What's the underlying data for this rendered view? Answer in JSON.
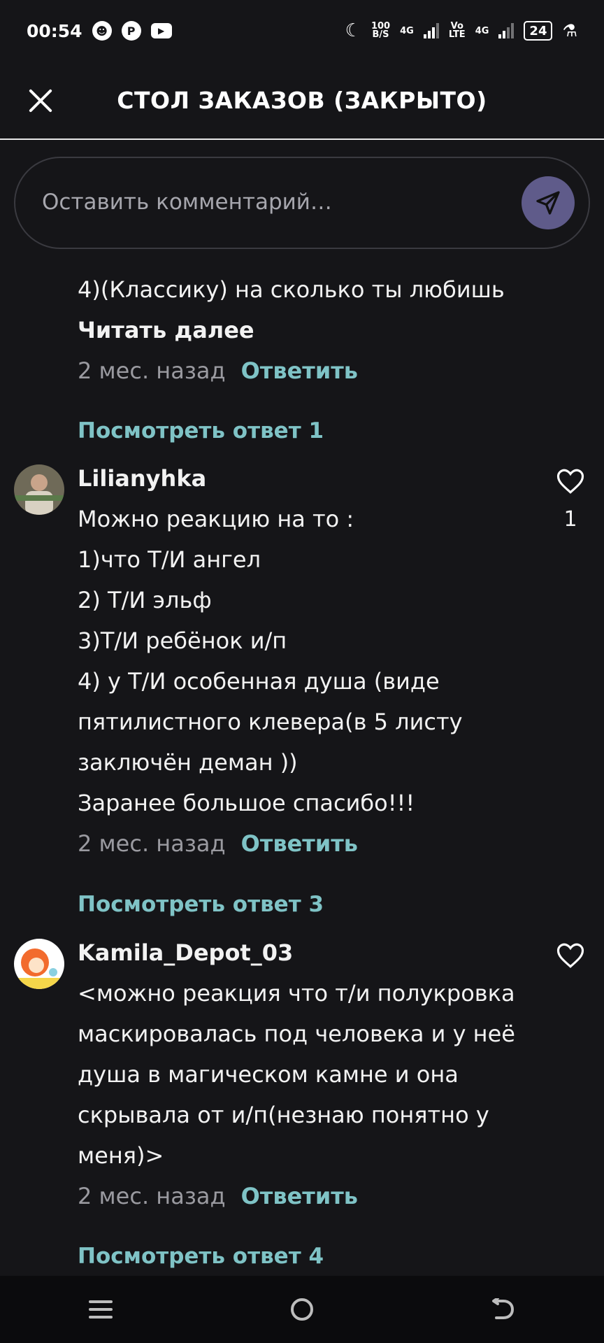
{
  "status_bar": {
    "time": "00:54",
    "net_speed_value": "100",
    "net_speed_unit": "B/S",
    "network1": "4G",
    "network2_top": "Vo",
    "network2_bottom": "LTE",
    "network3": "4G",
    "battery": "24"
  },
  "header": {
    "title": "СТОЛ ЗАКАЗОВ (ЗАКРЫТО)"
  },
  "comment_input": {
    "placeholder": "Оставить комментарий…"
  },
  "comments": [
    {
      "lines": [
        "4)(Классику) на сколько ты любишь"
      ],
      "read_more": "Читать далее",
      "time": "2 мес. назад",
      "reply": "Ответить",
      "view_replies": "Посмотреть ответ 1"
    },
    {
      "author": "Lilianyhka",
      "likes": "1",
      "lines": [
        "Можно реакцию на то :",
        "1)что Т/И ангел",
        "2) Т/И эльф",
        "3)Т/И ребёнок и/п",
        "4) у Т/И особенная душа (виде",
        "пятилистного клевера(в 5 листу",
        "заключён деман ))",
        "Заранее большое спасибо!!!"
      ],
      "time": "2 мес. назад",
      "reply": "Ответить",
      "view_replies": "Посмотреть ответ 3"
    },
    {
      "author": "Kamila_Depot_03",
      "lines": [
        "<можно реакция что т/и полукровка",
        "маскировалась под человека и у неё",
        "душа в магическом камне и она",
        "скрывала от и/п(незнаю понятно у",
        "меня)>"
      ],
      "time": "2 мес. назад",
      "reply": "Ответить",
      "view_replies": "Посмотреть ответ 4"
    }
  ],
  "icons": {
    "close": "close-icon",
    "send": "send-icon",
    "heart": "heart-icon",
    "nav_menu": "menu-icon",
    "nav_home": "home-icon",
    "nav_back": "back-icon"
  },
  "colors": {
    "background": "#151518",
    "accent": "#7fc3c6",
    "send_button": "#5f5b8a",
    "muted": "#9a9aa0"
  }
}
